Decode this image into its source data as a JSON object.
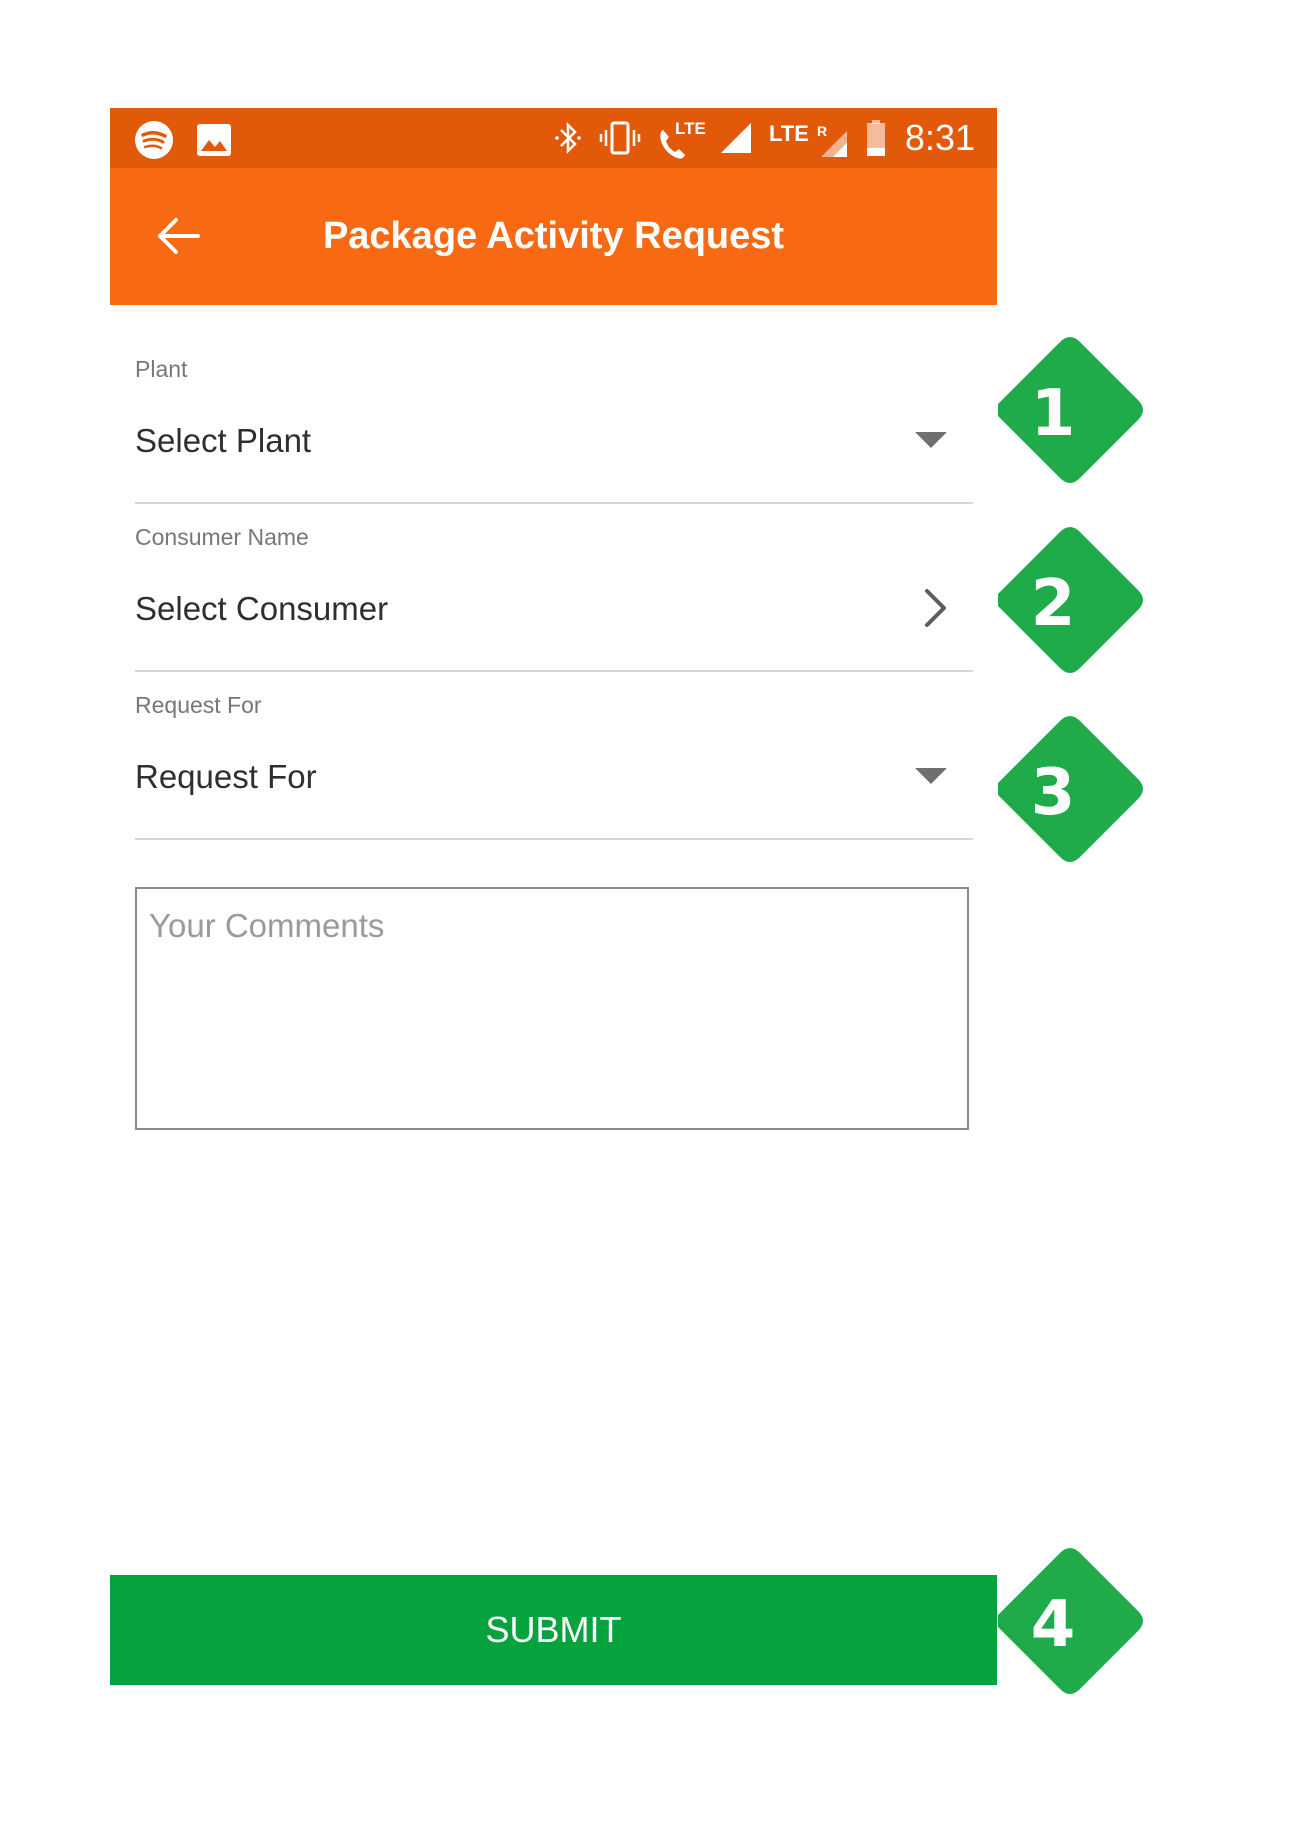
{
  "status_bar": {
    "time": "8:31",
    "left_icons": [
      "spotify-icon",
      "image-icon"
    ],
    "right_icons": [
      "bluetooth-icon",
      "vibrate-icon",
      "lte-call-icon",
      "signal-icon",
      "lte-roaming-icon",
      "battery-low-icon"
    ],
    "lte_label": "LTE",
    "lte_call_label": "LTE",
    "roaming_label": "R"
  },
  "app_bar": {
    "title": "Package Activity Request",
    "back_icon": "arrow-left-icon"
  },
  "form": {
    "plant": {
      "label": "Plant",
      "value": "Select Plant",
      "indicator": "dropdown-arrow-icon"
    },
    "consumer": {
      "label": "Consumer Name",
      "value": "Select Consumer",
      "indicator": "chevron-right-icon"
    },
    "request_for": {
      "label": "Request For",
      "value": "Request For",
      "indicator": "dropdown-arrow-icon"
    },
    "comments": {
      "placeholder": "Your Comments"
    }
  },
  "submit_label": "SUBMIT",
  "markers": [
    "1",
    "2",
    "3",
    "4"
  ],
  "colors": {
    "status_bar": "#e3590a",
    "app_bar": "#f86914",
    "submit": "#05a33d",
    "marker": "#20ab4b"
  }
}
